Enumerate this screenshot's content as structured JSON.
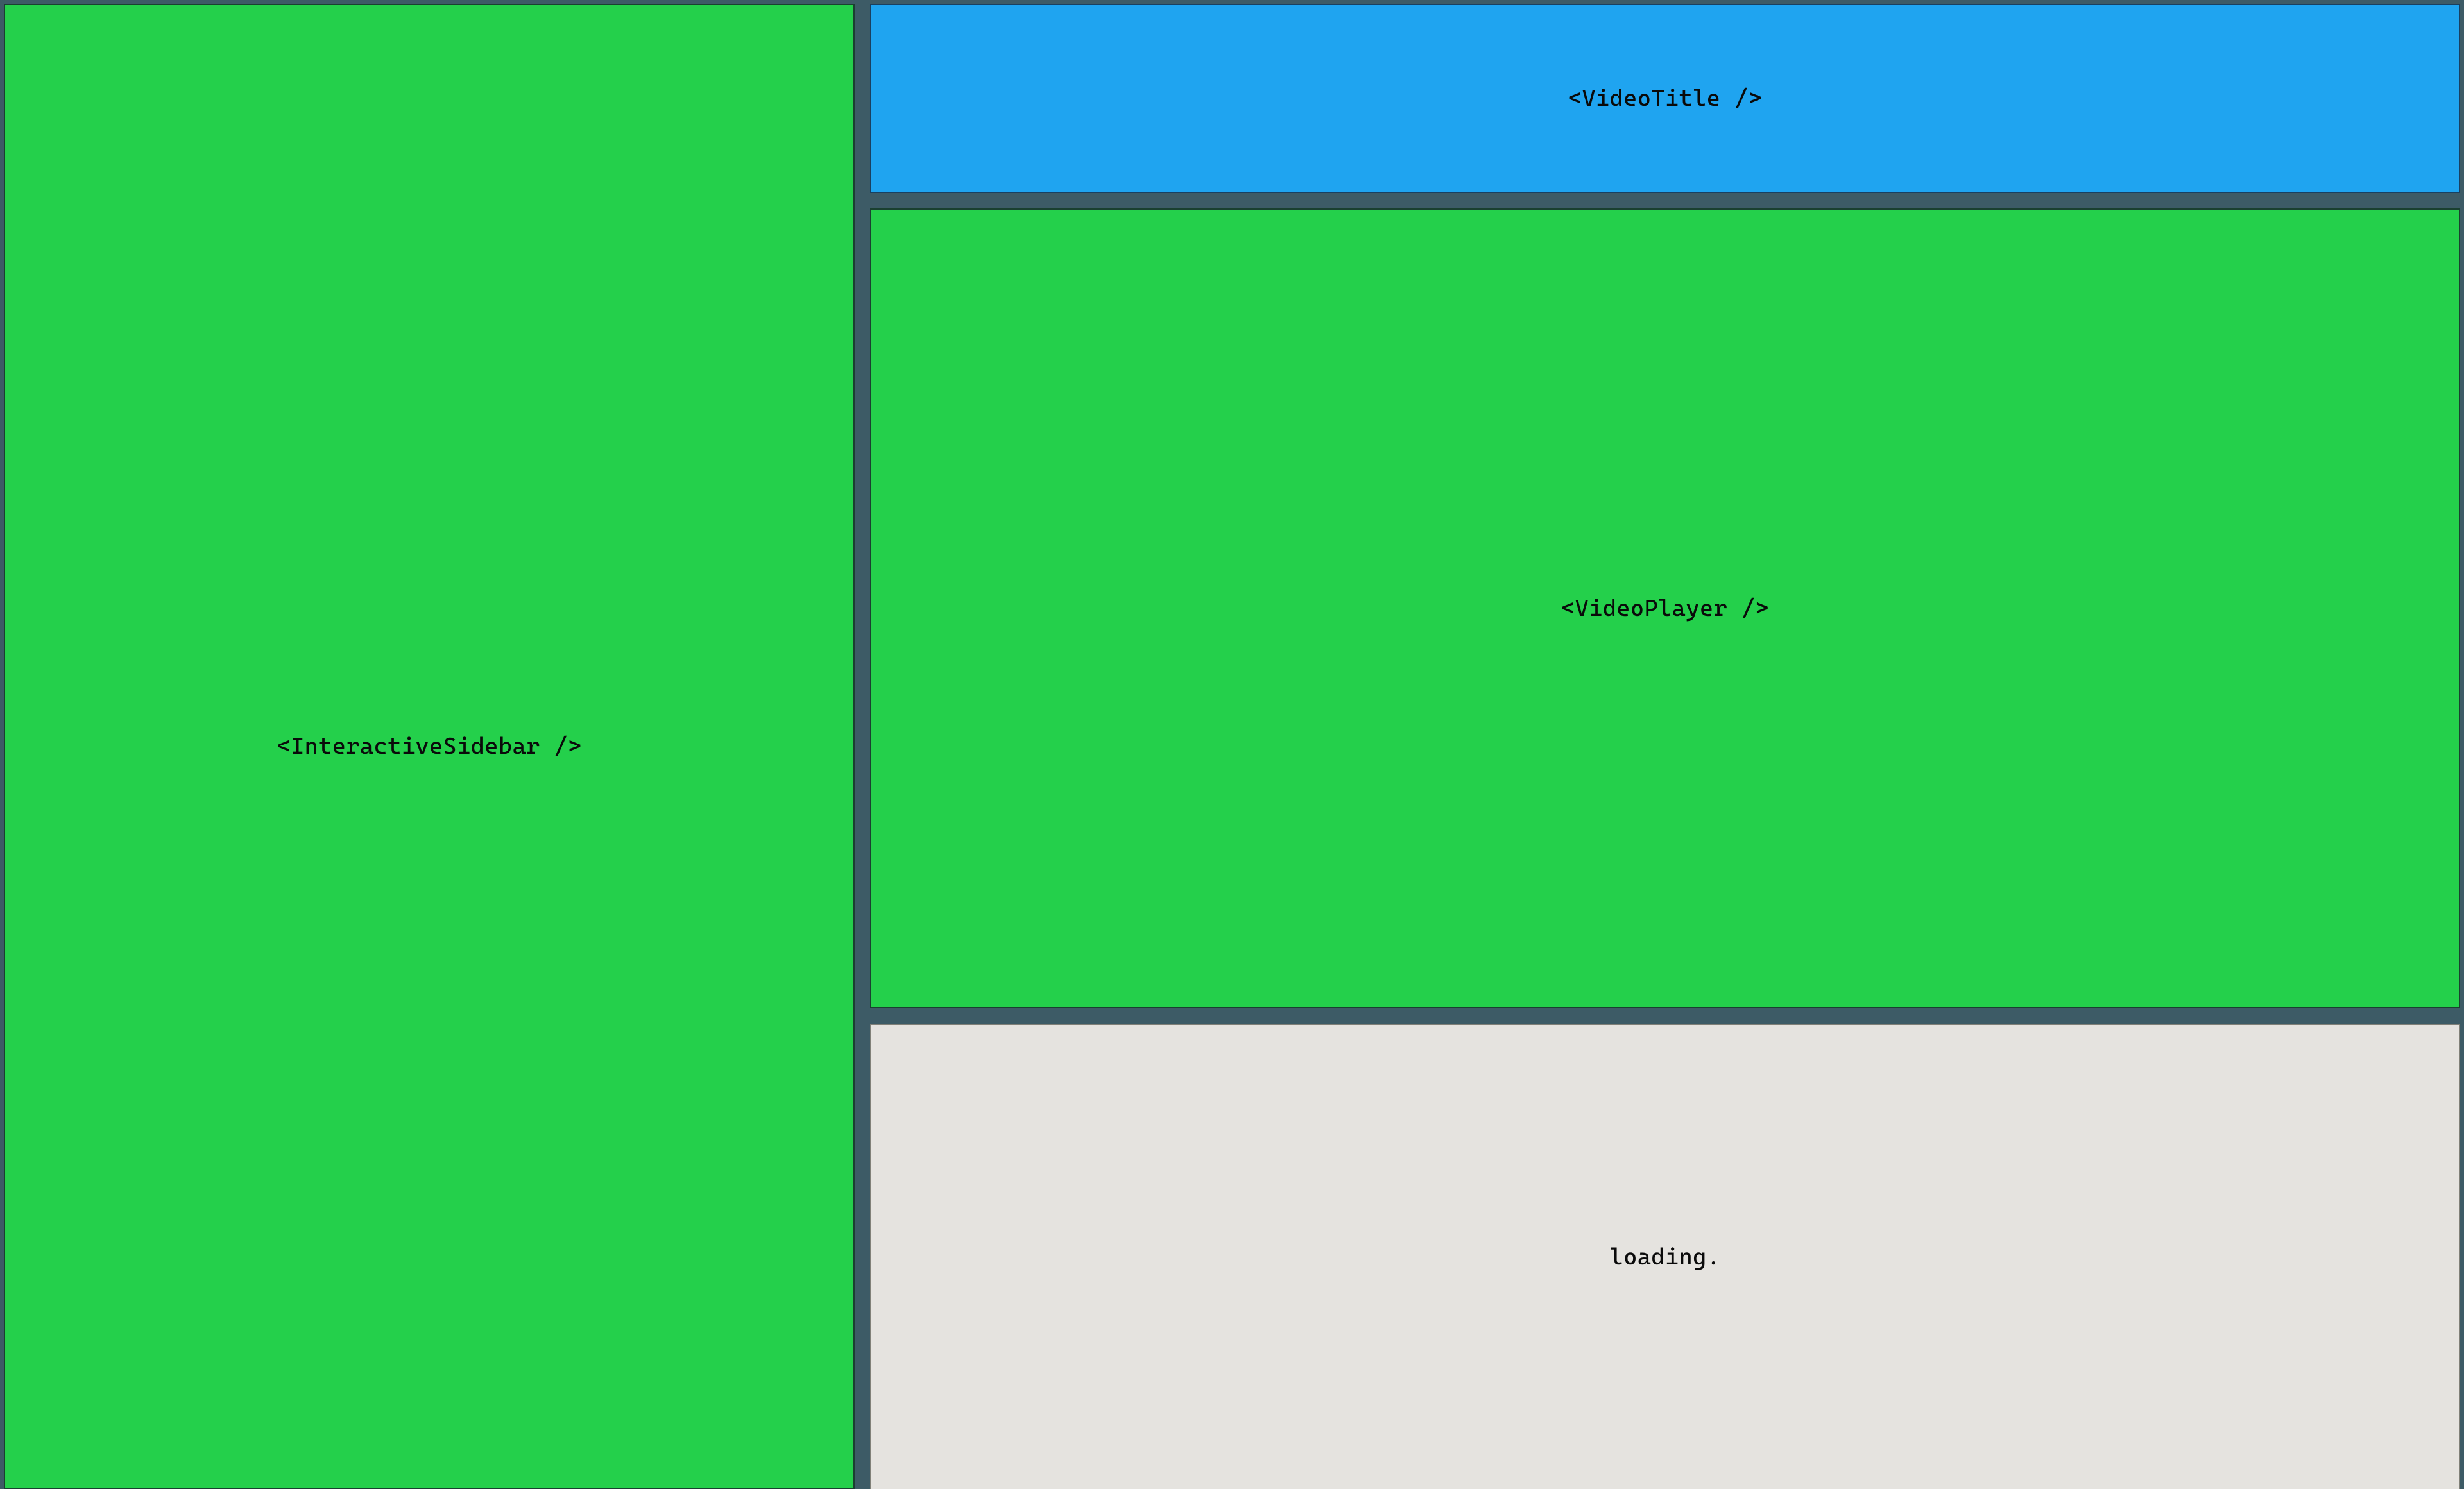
{
  "layout": {
    "sidebar": {
      "label": "<InteractiveSidebar />"
    },
    "main": {
      "title": {
        "label": "<VideoTitle />"
      },
      "player": {
        "label": "<VideoPlayer />"
      },
      "loading": {
        "label": "loading."
      }
    }
  },
  "colors": {
    "background": "#3d5b66",
    "green": "#24d04b",
    "blue": "#1fa4f0",
    "gray": "#e5e3df"
  }
}
